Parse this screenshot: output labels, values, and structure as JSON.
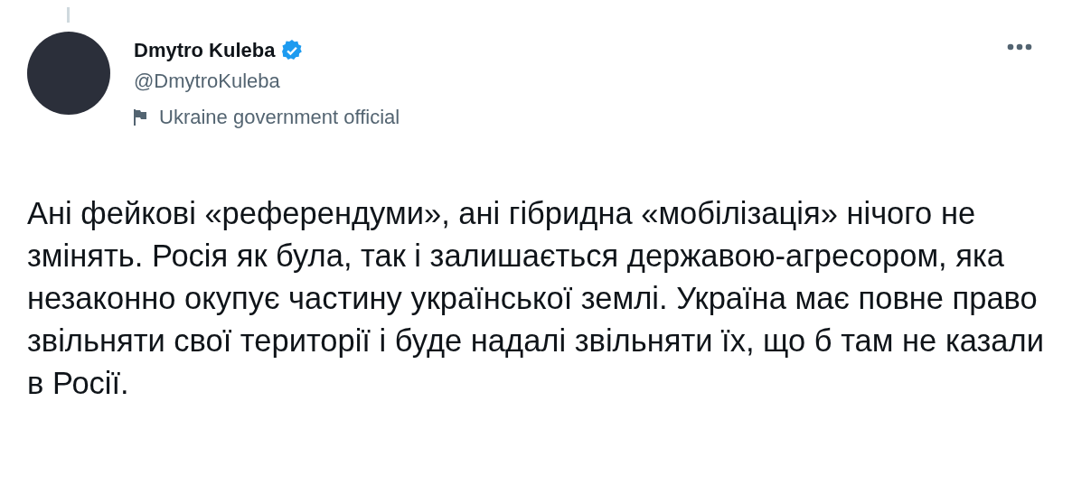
{
  "author": {
    "name": "Dmytro Kuleba",
    "verified": true,
    "handle": "@DmytroKuleba",
    "label": "Ukraine government official"
  },
  "tweet": {
    "text": "Ані фейкові «референдуми», ані гібридна «мобілізація» нічого не змінять. Росія як була, так і залишається державою-агресором, яка незаконно окупує частину української землі. Україна має повне право звільняти свої території і буде надалі звільняти їх, що б там не казали в Росії."
  }
}
